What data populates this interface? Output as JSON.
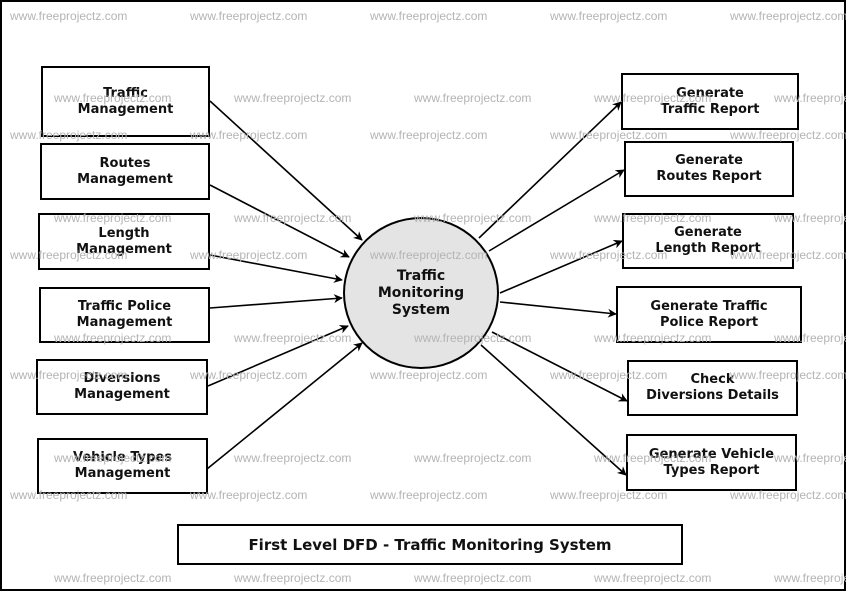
{
  "diagram": {
    "title": "First Level DFD - Traffic Monitoring System",
    "process": {
      "id": "traffic-monitoring-system",
      "label": "Traffic\nMonitoring\nSystem"
    },
    "inputs": [
      {
        "id": "traffic-management",
        "label": "Traffic\nManagement"
      },
      {
        "id": "routes-management",
        "label": "Routes\nManagement"
      },
      {
        "id": "length-management",
        "label": "Length\nManagement"
      },
      {
        "id": "traffic-police-management",
        "label": "Traffic Police\nManagement"
      },
      {
        "id": "diversions-management",
        "label": "Diversions\nManagement"
      },
      {
        "id": "vehicle-types-management",
        "label": "Vehicle Types\nManagement"
      }
    ],
    "outputs": [
      {
        "id": "generate-traffic-report",
        "label": "Generate\nTraffic Report"
      },
      {
        "id": "generate-routes-report",
        "label": "Generate\nRoutes Report"
      },
      {
        "id": "generate-length-report",
        "label": "Generate\nLength Report"
      },
      {
        "id": "generate-traffic-police-report",
        "label": "Generate Traffic\nPolice Report"
      },
      {
        "id": "check-diversions-details",
        "label": "Check\nDiversions Details"
      },
      {
        "id": "generate-vehicle-types-report",
        "label": "Generate Vehicle\nTypes Report"
      }
    ],
    "flows": [
      {
        "from": "traffic-management",
        "to": "traffic-monitoring-system"
      },
      {
        "from": "routes-management",
        "to": "traffic-monitoring-system"
      },
      {
        "from": "length-management",
        "to": "traffic-monitoring-system"
      },
      {
        "from": "traffic-police-management",
        "to": "traffic-monitoring-system"
      },
      {
        "from": "diversions-management",
        "to": "traffic-monitoring-system"
      },
      {
        "from": "vehicle-types-management",
        "to": "traffic-monitoring-system"
      },
      {
        "from": "traffic-monitoring-system",
        "to": "generate-traffic-report"
      },
      {
        "from": "traffic-monitoring-system",
        "to": "generate-routes-report"
      },
      {
        "from": "traffic-monitoring-system",
        "to": "generate-length-report"
      },
      {
        "from": "traffic-monitoring-system",
        "to": "generate-traffic-police-report"
      },
      {
        "from": "traffic-monitoring-system",
        "to": "check-diversions-details"
      },
      {
        "from": "traffic-monitoring-system",
        "to": "generate-vehicle-types-report"
      }
    ]
  },
  "watermark": {
    "text": "www.freeprojectz.com",
    "color": "#b4b4b4"
  }
}
